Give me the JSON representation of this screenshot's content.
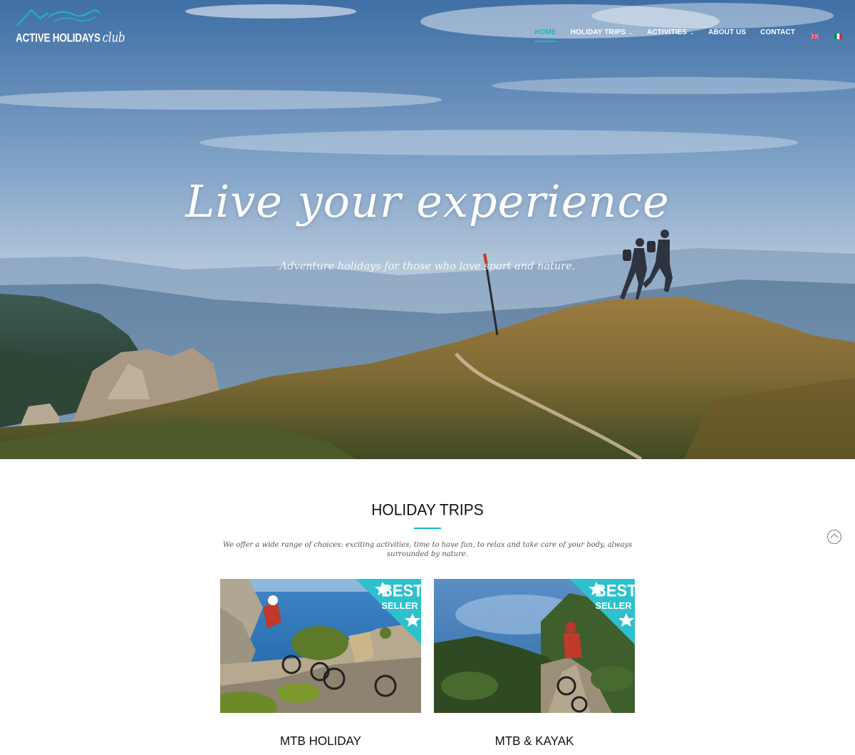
{
  "brand": {
    "name": "ACTIVE HOLIDAYS",
    "suffix": "club",
    "accent_color": "#1fb5c6"
  },
  "nav": {
    "items": [
      {
        "label": "HOME",
        "active": true,
        "has_dropdown": false
      },
      {
        "label": "HOLIDAY TRIPS",
        "active": false,
        "has_dropdown": true
      },
      {
        "label": "ACTIVITIES",
        "active": false,
        "has_dropdown": true
      },
      {
        "label": "ABOUT US",
        "active": false,
        "has_dropdown": false
      },
      {
        "label": "CONTACT",
        "active": false,
        "has_dropdown": false
      }
    ],
    "caret": "⌄",
    "languages": [
      {
        "icon": "uk-flag-icon"
      },
      {
        "icon": "italy-flag-icon"
      }
    ]
  },
  "hero": {
    "title": "Live your experience",
    "subtitle": "Adventure holidays for those who love sport and nature."
  },
  "section": {
    "title": "HOLIDAY TRIPS",
    "description": "We offer a wide range of choices: exciting activities, time to have fun, to relax and take care of your body, always surrounded by nature."
  },
  "cards": [
    {
      "title": "MTB HOLIDAY",
      "badge_line1": "BEST",
      "badge_line2": "SELLER"
    },
    {
      "title": "MTB & KAYAK",
      "badge_line1": "BEST",
      "badge_line2": "SELLER"
    }
  ],
  "scroll_top": {
    "icon": "chevron-up-icon"
  }
}
